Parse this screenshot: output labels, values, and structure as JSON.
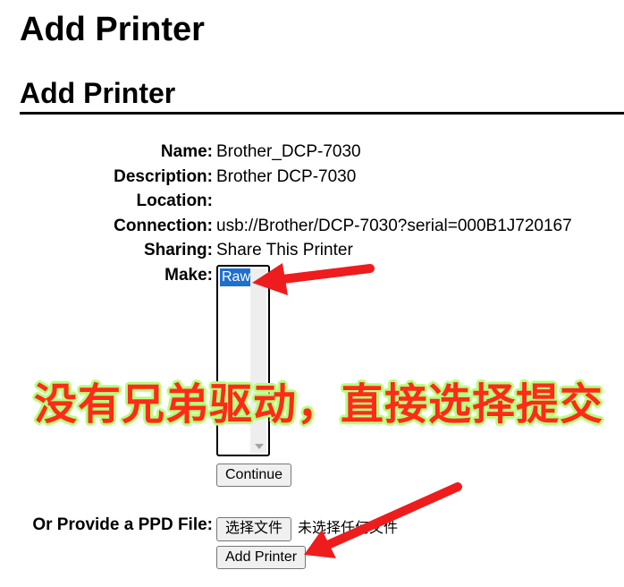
{
  "page": {
    "title": "Add Printer",
    "subtitle": "Add Printer"
  },
  "fields": {
    "name": {
      "label": "Name:",
      "value": "Brother_DCP-7030"
    },
    "description": {
      "label": "Description:",
      "value": "Brother DCP-7030"
    },
    "location": {
      "label": "Location:",
      "value": ""
    },
    "connection": {
      "label": "Connection:",
      "value": "usb://Brother/DCP-7030?serial=000B1J720167"
    },
    "sharing": {
      "label": "Sharing:",
      "value": "Share This Printer"
    },
    "make": {
      "label": "Make:",
      "options": [
        "Raw"
      ],
      "selected": "Raw"
    }
  },
  "buttons": {
    "continue": "Continue",
    "add_printer": "Add Printer"
  },
  "ppd": {
    "label": "Or Provide a PPD File:",
    "choose_button": "选择文件",
    "status": "未选择任何文件"
  },
  "annotation": {
    "text": "没有兄弟驱动，直接选择提交",
    "color": "#ff2a1a",
    "outline": "#b6ff7a"
  }
}
